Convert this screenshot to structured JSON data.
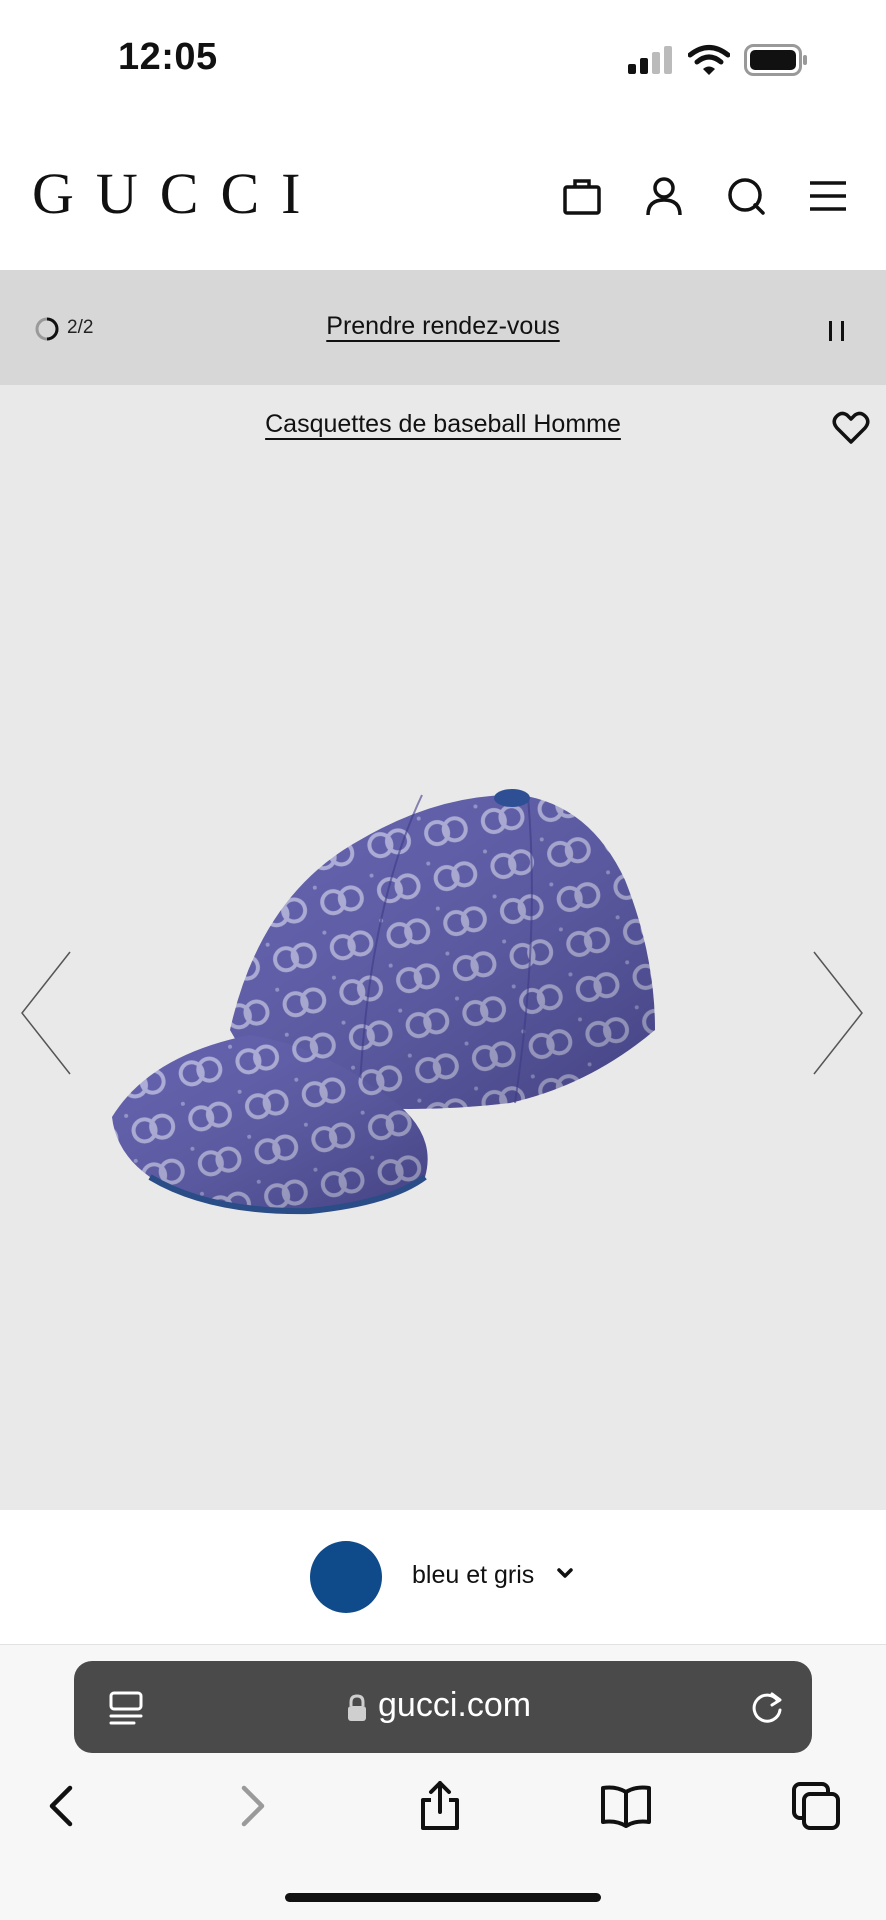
{
  "status_bar": {
    "time": "12:05",
    "icons": [
      "signal-icon",
      "wifi-icon",
      "battery-icon"
    ]
  },
  "header": {
    "brand": "GUCCI",
    "icons": [
      "bag-icon",
      "account-icon",
      "search-icon",
      "menu-icon"
    ]
  },
  "promo": {
    "counter": "2/2",
    "link": "Prendre rendez-vous",
    "icons": [
      "spinner-icon",
      "pause-icon"
    ]
  },
  "product": {
    "breadcrumb": "Casquettes de baseball Homme",
    "image_subject": "blue GG canvas baseball cap",
    "icons": [
      "heart-icon",
      "chevron-left-icon",
      "chevron-right-icon"
    ]
  },
  "color_selector": {
    "selected": "bleu et gris",
    "swatch_color": "#0f4a8a",
    "icons": [
      "chevron-down-icon"
    ]
  },
  "browser": {
    "url": "gucci.com",
    "icons": [
      "reader-icon",
      "lock-icon",
      "reload-icon",
      "back-icon",
      "forward-icon",
      "share-icon",
      "bookmarks-icon",
      "tabs-icon"
    ]
  },
  "colors": {
    "promo_bg": "#d7d7d7",
    "image_bg": "#e9e9e9",
    "address_bar": "#4a4a4a"
  }
}
